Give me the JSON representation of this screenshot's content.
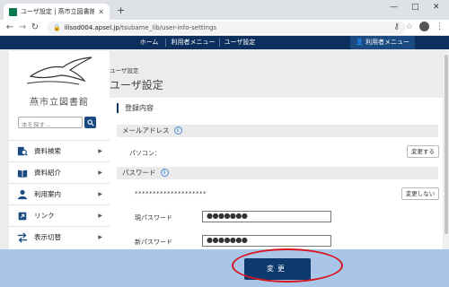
{
  "browser": {
    "tab_title": "ユーザ設定 | 燕市立図書館",
    "tab_close": "✕",
    "new_tab": "+",
    "window": {
      "minimize": "—",
      "maximize": "□",
      "close": "✕"
    },
    "url_host": "ilisod004.apsel.jp",
    "url_path": "/tsubame_lib/user-info-settings"
  },
  "topnav": {
    "home": "ホーム",
    "user_menu": "利用者メニュー",
    "user_settings": "ユーザ設定",
    "user_menu_button": "利用者メニュー"
  },
  "sidebar": {
    "library_name": "燕市立図書館",
    "search_placeholder": "本を探す…",
    "items": [
      {
        "label": "資料検索",
        "icon": "search-book-icon"
      },
      {
        "label": "資料紹介",
        "icon": "open-book-icon"
      },
      {
        "label": "利用案内",
        "icon": "person-icon"
      },
      {
        "label": "リンク",
        "icon": "link-icon"
      },
      {
        "label": "表示切替",
        "icon": "switch-arrows-icon"
      }
    ]
  },
  "main": {
    "breadcrumb": "ユーザ設定",
    "title": "ユーザ設定",
    "section_title": "登録内容",
    "email": {
      "header": "メールアドレス",
      "pc_label": "パソコン：",
      "change_button": "変更する"
    },
    "password": {
      "header": "パスワード",
      "masked": "********************",
      "no_change_button": "変更しない",
      "current_label": "現パスワード",
      "current_value": "●●●●●●●",
      "new_label": "新パスワード",
      "new_value": "●●●●●●●"
    },
    "submit_label": "変更"
  },
  "colors": {
    "nav": "#0d2f5e",
    "bottom_bar": "#a9c6e8",
    "highlight_ring": "#d7161f"
  }
}
